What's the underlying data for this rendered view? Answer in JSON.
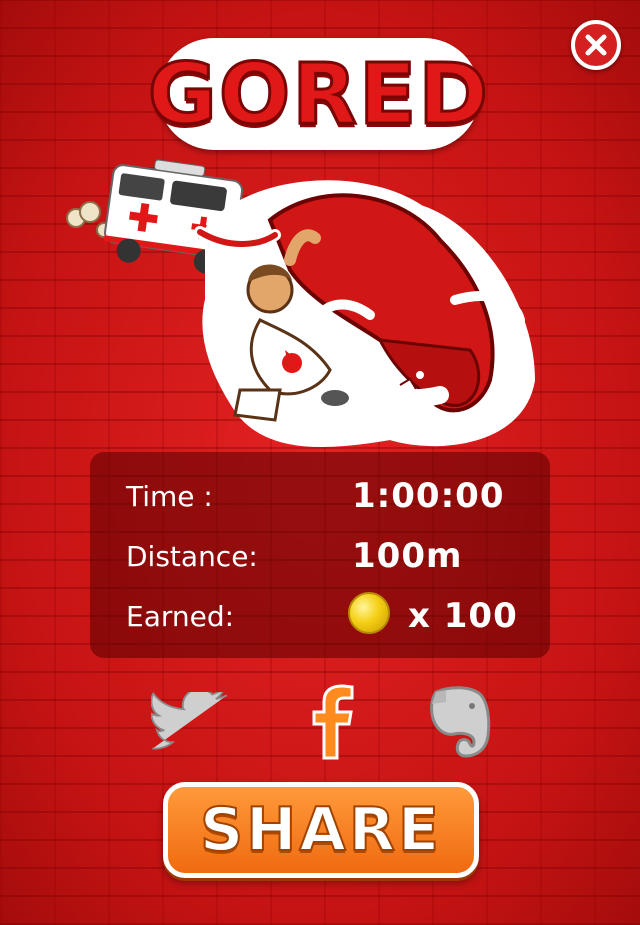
{
  "title": "GORED",
  "stats": [
    {
      "label": "Time :",
      "value": "1:00:00"
    },
    {
      "label": "Distance:",
      "value": "100m"
    },
    {
      "label": "Earned:",
      "value": "x 100"
    }
  ],
  "share_label": "SHARE",
  "colors": {
    "background": "#d11a1a",
    "accent": "#e01818",
    "share_button": "#f37a1a"
  },
  "icons": [
    "close-icon",
    "twitter-icon",
    "facebook-icon",
    "evernote-icon",
    "coin-icon"
  ]
}
